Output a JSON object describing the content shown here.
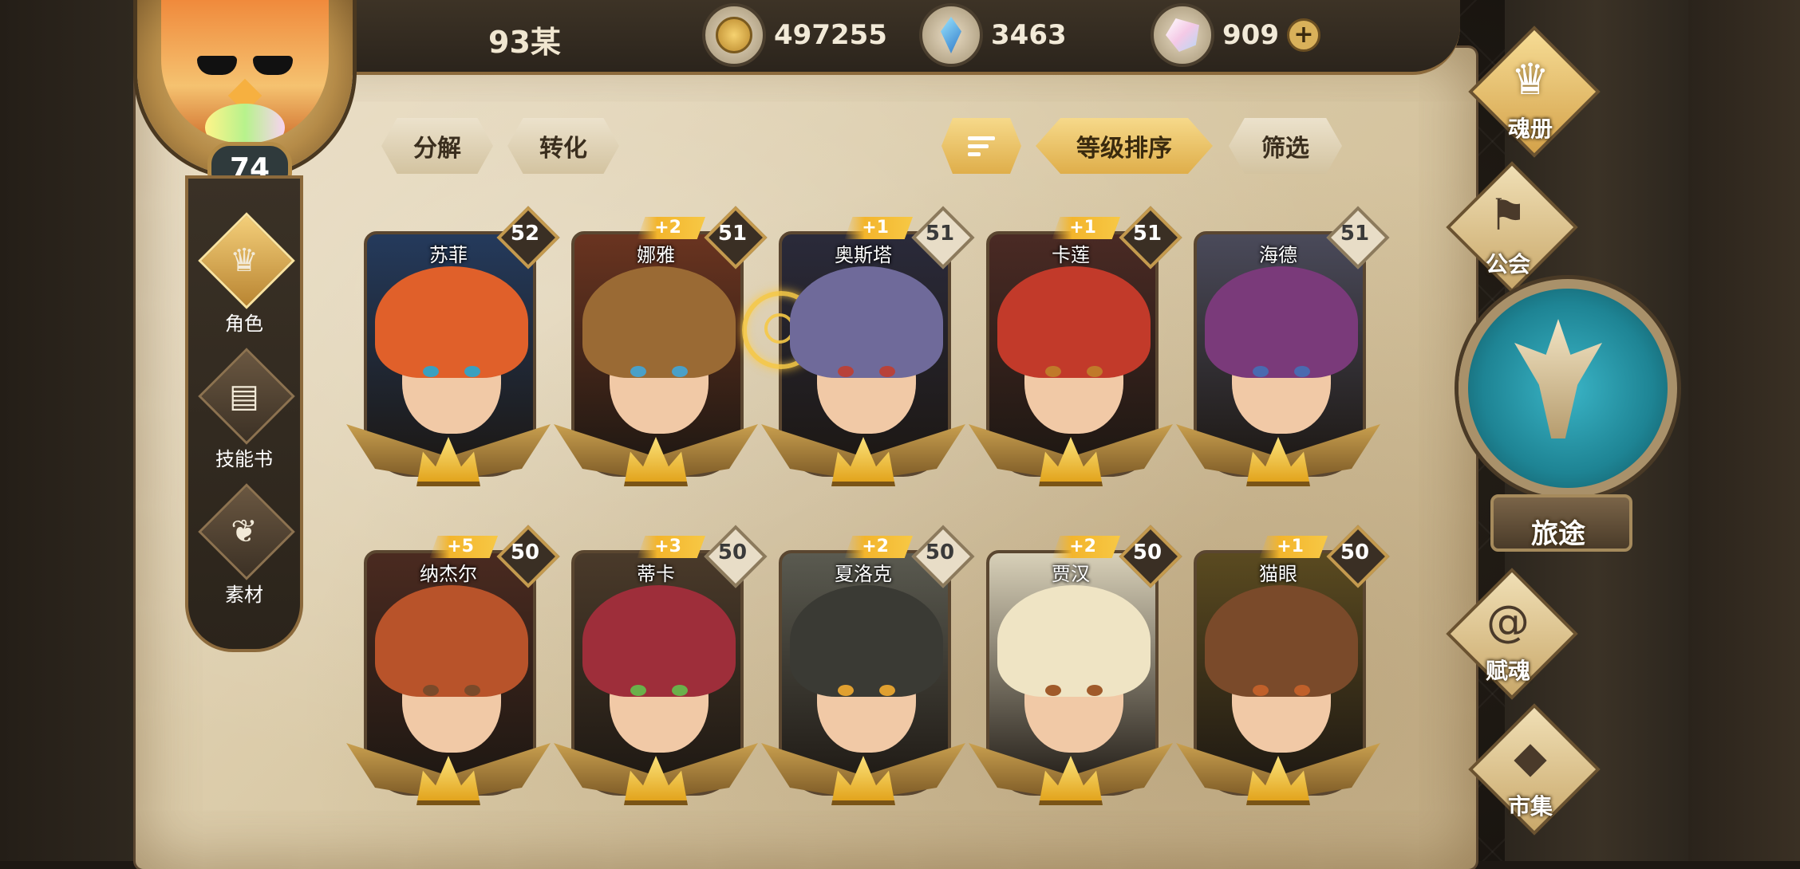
{
  "player": {
    "name": "93某",
    "level": "74"
  },
  "currencies": [
    {
      "icon": "gold-coin-icon",
      "value": "497255"
    },
    {
      "icon": "blue-gem-icon",
      "value": "3463"
    },
    {
      "icon": "crystal-icon",
      "value": "909"
    }
  ],
  "actions": {
    "decompose": "分解",
    "convert": "转化",
    "sort_level": "等级排序",
    "filter": "筛选"
  },
  "left_nav": [
    {
      "label": "角色",
      "icon": "helmet-icon",
      "active": true
    },
    {
      "label": "技能书",
      "icon": "book-icon",
      "active": false
    },
    {
      "label": "素材",
      "icon": "wings-icon",
      "active": false
    }
  ],
  "cards": [
    {
      "name": "苏菲",
      "level": "52",
      "plus": "",
      "light": false,
      "hair": "#e0602a",
      "eye": "#3aa0c0",
      "bg": "#243a5c"
    },
    {
      "name": "娜雅",
      "level": "51",
      "plus": "+2",
      "light": false,
      "hair": "#9a6a34",
      "eye": "#4aa0c8",
      "bg": "#6a3420"
    },
    {
      "name": "奥斯塔",
      "level": "51",
      "plus": "+1",
      "light": true,
      "hair": "#6f6a9a",
      "eye": "#b8423a",
      "bg": "#2a2a3a"
    },
    {
      "name": "卡莲",
      "level": "51",
      "plus": "+1",
      "light": false,
      "hair": "#c23a2a",
      "eye": "#c07a2a",
      "bg": "#4a2a24"
    },
    {
      "name": "海德",
      "level": "51",
      "plus": "",
      "light": true,
      "hair": "#7a3a7a",
      "eye": "#4a6ab0",
      "bg": "#4a4a5a"
    },
    {
      "name": "纳杰尔",
      "level": "50",
      "plus": "+5",
      "light": false,
      "hair": "#b8532a",
      "eye": "#7a4a2a",
      "bg": "#4a2a20"
    },
    {
      "name": "蒂卡",
      "level": "50",
      "plus": "+3",
      "light": true,
      "hair": "#9e2e3a",
      "eye": "#6ab04a",
      "bg": "#4a3a2a"
    },
    {
      "name": "夏洛克",
      "level": "50",
      "plus": "+2",
      "light": true,
      "hair": "#3a3a34",
      "eye": "#e0a030",
      "bg": "#5a5a50"
    },
    {
      "name": "贾汉",
      "level": "50",
      "plus": "+2",
      "light": false,
      "hair": "#efe4c4",
      "eye": "#a05a2a",
      "bg": "#d8d0b8"
    },
    {
      "name": "猫眼",
      "level": "50",
      "plus": "+1",
      "light": false,
      "hair": "#7a4a2a",
      "eye": "#c0602a",
      "bg": "#5a4a20"
    }
  ],
  "right_menu": [
    {
      "label": "魂册",
      "icon": "helmet-icon",
      "active": true
    },
    {
      "label": "公会",
      "icon": "banner-icon",
      "active": false
    },
    {
      "label": "旅途",
      "icon": "journey-emblem-icon",
      "active": false
    },
    {
      "label": "赋魂",
      "icon": "swirl-icon",
      "active": false
    },
    {
      "label": "市集",
      "icon": "gem-icon",
      "active": false
    }
  ]
}
